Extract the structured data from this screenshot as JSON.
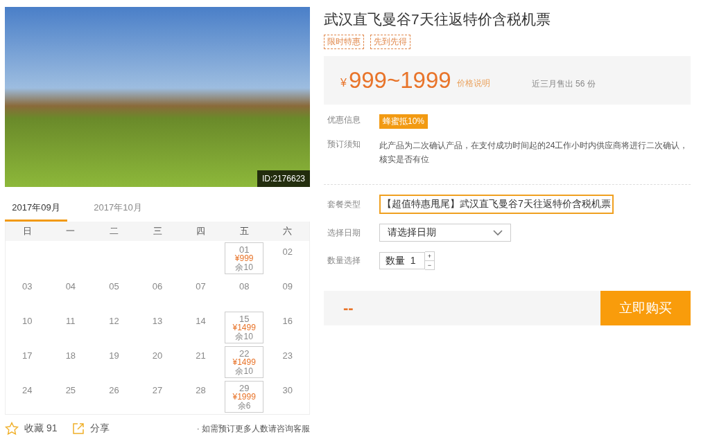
{
  "photo": {
    "id_badge": "ID:2176623"
  },
  "calendar": {
    "tabs": [
      {
        "label": "2017年09月",
        "selected": true
      },
      {
        "label": "2017年10月",
        "selected": false
      }
    ],
    "weekdays": [
      "日",
      "一",
      "二",
      "三",
      "四",
      "五",
      "六"
    ],
    "weeks": [
      [
        {
          "kind": "blank"
        },
        {
          "kind": "blank"
        },
        {
          "kind": "blank"
        },
        {
          "kind": "blank"
        },
        {
          "kind": "blank"
        },
        {
          "kind": "available",
          "day": "01",
          "price": "¥999",
          "stock": "余10"
        },
        {
          "kind": "day",
          "day": "02"
        }
      ],
      [
        {
          "kind": "day",
          "day": "03"
        },
        {
          "kind": "day",
          "day": "04"
        },
        {
          "kind": "day",
          "day": "05"
        },
        {
          "kind": "day",
          "day": "06"
        },
        {
          "kind": "day",
          "day": "07"
        },
        {
          "kind": "day",
          "day": "08"
        },
        {
          "kind": "day",
          "day": "09"
        }
      ],
      [
        {
          "kind": "day",
          "day": "10"
        },
        {
          "kind": "day",
          "day": "11"
        },
        {
          "kind": "day",
          "day": "12"
        },
        {
          "kind": "day",
          "day": "13"
        },
        {
          "kind": "day",
          "day": "14"
        },
        {
          "kind": "available",
          "day": "15",
          "price": "¥1499",
          "stock": "余10"
        },
        {
          "kind": "day",
          "day": "16"
        }
      ],
      [
        {
          "kind": "day",
          "day": "17"
        },
        {
          "kind": "day",
          "day": "18"
        },
        {
          "kind": "day",
          "day": "19"
        },
        {
          "kind": "day",
          "day": "20"
        },
        {
          "kind": "day",
          "day": "21"
        },
        {
          "kind": "available",
          "day": "22",
          "price": "¥1499",
          "stock": "余10"
        },
        {
          "kind": "day",
          "day": "23"
        }
      ],
      [
        {
          "kind": "day",
          "day": "24"
        },
        {
          "kind": "day",
          "day": "25"
        },
        {
          "kind": "day",
          "day": "26"
        },
        {
          "kind": "day",
          "day": "27"
        },
        {
          "kind": "day",
          "day": "28"
        },
        {
          "kind": "available",
          "day": "29",
          "price": "¥1999",
          "stock": "余6"
        },
        {
          "kind": "day",
          "day": "30"
        }
      ]
    ]
  },
  "footer": {
    "favorite": "收藏 91",
    "share": "分享",
    "note": "· 如需预订更多人数请咨询客服"
  },
  "title": "武汉直飞曼谷7天往返特价含税机票",
  "tags": [
    "限时特惠",
    "先到先得"
  ],
  "price": {
    "currency": "¥",
    "range": "999~1999",
    "explain": "价格说明",
    "sold": "近三月售出 56 份"
  },
  "info": [
    {
      "label": "优惠信息",
      "kind": "badge",
      "value": "蜂蜜抵10%"
    },
    {
      "label": "预订须知",
      "kind": "text",
      "value": "此产品为二次确认产品，在支付成功时间起的24工作小时内供应商将进行二次确认，核实是否有位"
    }
  ],
  "form": {
    "package_label": "套餐类型",
    "package": "【超值特惠甩尾】武汉直飞曼谷7天往返特价含税机票",
    "date_label": "选择日期",
    "date_placeholder": "请选择日期",
    "qty_label": "数量选择",
    "qty_prefix": "数量",
    "qty": "1",
    "plus": "+",
    "minus": "−"
  },
  "buy": {
    "total": "--",
    "button": "立即购买"
  }
}
